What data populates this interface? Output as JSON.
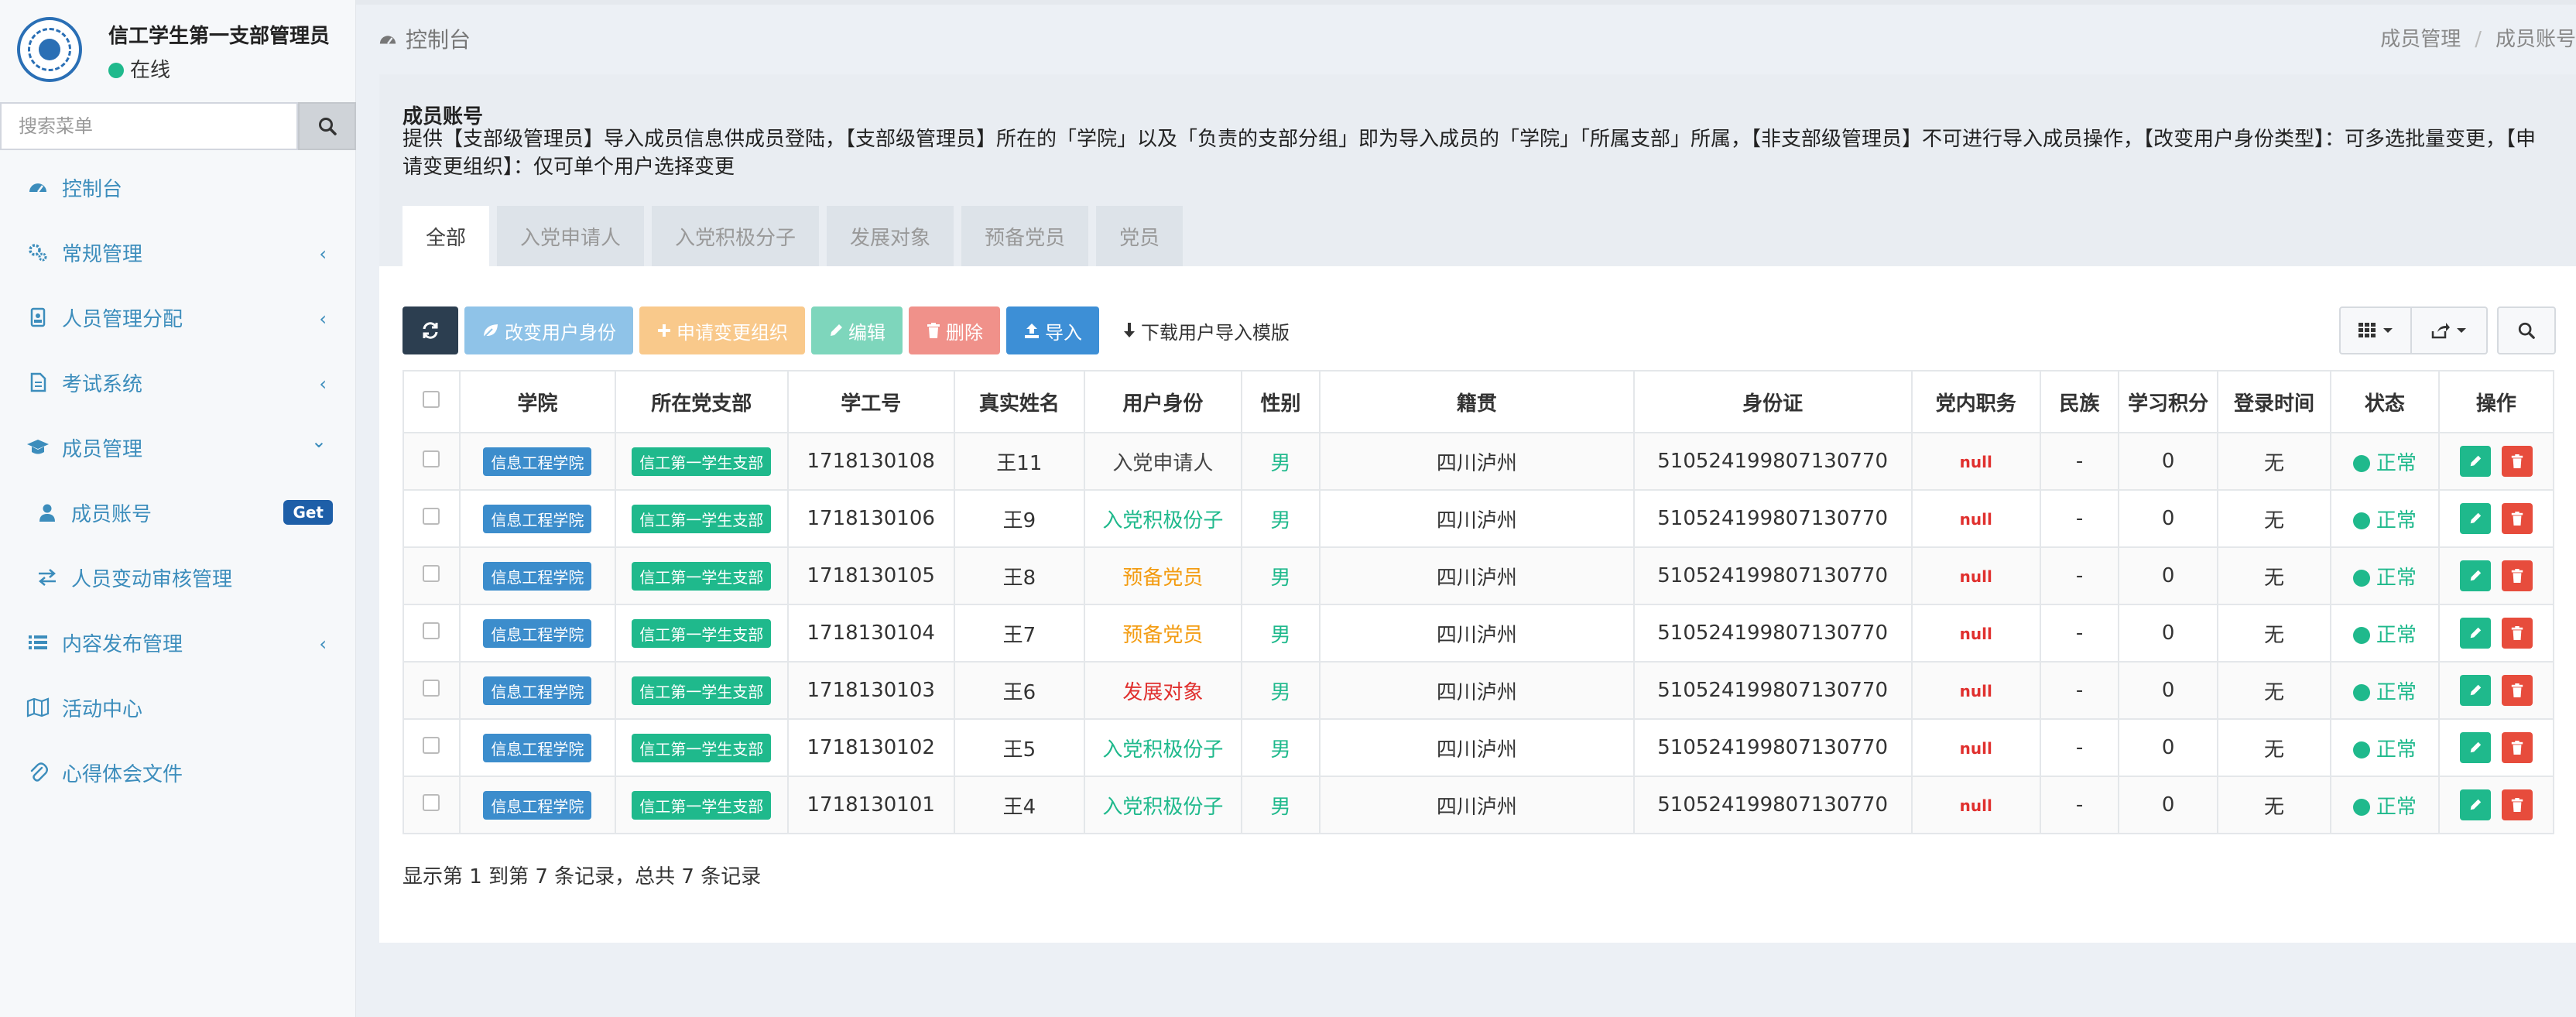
{
  "sidebar": {
    "user_name": "信工学生第一支部管理员",
    "user_status": "在线",
    "search_placeholder": "搜索菜单",
    "menu": [
      {
        "label": "控制台",
        "icon": "dashboard-icon",
        "chevron": ""
      },
      {
        "label": "常规管理",
        "icon": "gears-icon",
        "chevron": "‹"
      },
      {
        "label": "人员管理分配",
        "icon": "id-badge-icon",
        "chevron": "‹"
      },
      {
        "label": "考试系统",
        "icon": "file-text-icon",
        "chevron": "‹"
      },
      {
        "label": "成员管理",
        "icon": "graduation-cap-icon",
        "chevron": "⌄"
      },
      {
        "label": "成员账号",
        "icon": "user-icon",
        "badge": "Get"
      },
      {
        "label": "人员变动审核管理",
        "icon": "exchange-icon"
      },
      {
        "label": "内容发布管理",
        "icon": "list-icon",
        "chevron": "‹"
      },
      {
        "label": "活动中心",
        "icon": "map-icon"
      },
      {
        "label": "心得体会文件",
        "icon": "paperclip-icon"
      }
    ]
  },
  "header": {
    "title": "控制台",
    "breadcrumb": [
      "成员管理",
      "成员账号"
    ]
  },
  "panel": {
    "title": "成员账号",
    "description": "提供【支部级管理员】导入成员信息供成员登陆，【支部级管理员】所在的「学院」以及「负责的支部分组」即为导入成员的「学院」「所属支部」所属，【非支部级管理员】不可进行导入成员操作，【改变用户身份类型】：可多选批量变更，【申请变更组织】：仅可单个用户选择变更",
    "tabs": [
      "全部",
      "入党申请人",
      "入党积极分子",
      "发展对象",
      "预备党员",
      "党员"
    ]
  },
  "toolbar": {
    "change_role": "改变用户身份",
    "apply_org": "申请变更组织",
    "edit": "编辑",
    "delete": "删除",
    "import": "导入",
    "download_template": "下载用户导入模版"
  },
  "table": {
    "headers": [
      "学院",
      "所在党支部",
      "学工号",
      "真实姓名",
      "用户身份",
      "性别",
      "籍贯",
      "身份证",
      "党内职务",
      "民族",
      "学习积分",
      "登录时间",
      "状态",
      "操作"
    ],
    "rows": [
      {
        "college": "信息工程学院",
        "branch": "信工第一学生支部",
        "id": "1718130108",
        "name": "王11",
        "role": "入党申请人",
        "role_color": "#444444",
        "gender": "男",
        "native": "四川泸州",
        "idcard": "510524199807130770",
        "duty": "null",
        "nation": "-",
        "score": "0",
        "login": "无",
        "status": "正常"
      },
      {
        "college": "信息工程学院",
        "branch": "信工第一学生支部",
        "id": "1718130106",
        "name": "王9",
        "role": "入党积极份子",
        "role_color": "#1fb98c",
        "gender": "男",
        "native": "四川泸州",
        "idcard": "510524199807130770",
        "duty": "null",
        "nation": "-",
        "score": "0",
        "login": "无",
        "status": "正常"
      },
      {
        "college": "信息工程学院",
        "branch": "信工第一学生支部",
        "id": "1718130105",
        "name": "王8",
        "role": "预备党员",
        "role_color": "#f39c12",
        "gender": "男",
        "native": "四川泸州",
        "idcard": "510524199807130770",
        "duty": "null",
        "nation": "-",
        "score": "0",
        "login": "无",
        "status": "正常"
      },
      {
        "college": "信息工程学院",
        "branch": "信工第一学生支部",
        "id": "1718130104",
        "name": "王7",
        "role": "预备党员",
        "role_color": "#f39c12",
        "gender": "男",
        "native": "四川泸州",
        "idcard": "510524199807130770",
        "duty": "null",
        "nation": "-",
        "score": "0",
        "login": "无",
        "status": "正常"
      },
      {
        "college": "信息工程学院",
        "branch": "信工第一学生支部",
        "id": "1718130103",
        "name": "王6",
        "role": "发展对象",
        "role_color": "#e0302e",
        "gender": "男",
        "native": "四川泸州",
        "idcard": "510524199807130770",
        "duty": "null",
        "nation": "-",
        "score": "0",
        "login": "无",
        "status": "正常"
      },
      {
        "college": "信息工程学院",
        "branch": "信工第一学生支部",
        "id": "1718130102",
        "name": "王5",
        "role": "入党积极份子",
        "role_color": "#1fb98c",
        "gender": "男",
        "native": "四川泸州",
        "idcard": "510524199807130770",
        "duty": "null",
        "nation": "-",
        "score": "0",
        "login": "无",
        "status": "正常"
      },
      {
        "college": "信息工程学院",
        "branch": "信工第一学生支部",
        "id": "1718130101",
        "name": "王4",
        "role": "入党积极份子",
        "role_color": "#1fb98c",
        "gender": "男",
        "native": "四川泸州",
        "idcard": "510524199807130770",
        "duty": "null",
        "nation": "-",
        "score": "0",
        "login": "无",
        "status": "正常"
      }
    ]
  },
  "footer": {
    "info": "显示第 1 到第 7 条记录，总共 7 条记录"
  }
}
